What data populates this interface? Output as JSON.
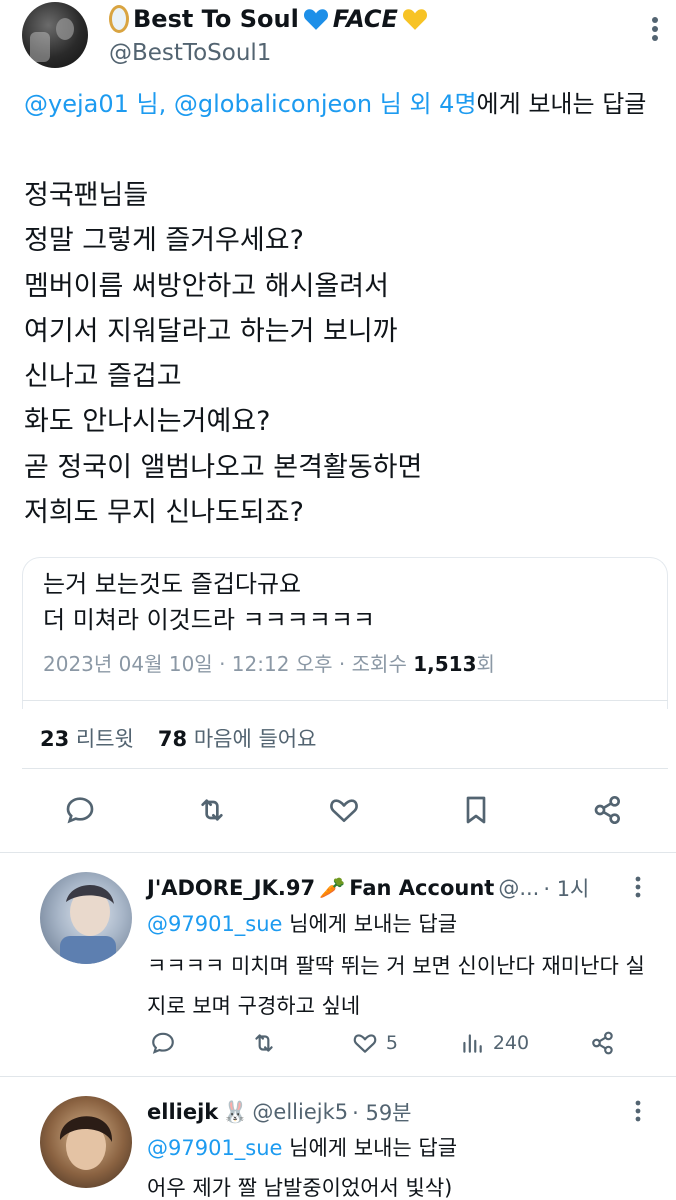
{
  "author": {
    "name_prefix": "Best To Soul",
    "name_face": "FACE",
    "handle": "@BestToSoul1",
    "blue_heart_color": "#1d8fe8",
    "yellow_heart_color": "#f7c325"
  },
  "reply_to": {
    "mention1": "@yeja01",
    "sep1": " 님, ",
    "mention2": "@globaliconjeon",
    "tail_link": " 님 외 4명",
    "suffix": "에게 보내는 답글"
  },
  "body_lines": [
    "정국팬님들",
    "정말 그렇게 즐거우세요?",
    "멤버이름 써방안하고 해시올려서",
    "여기서 지워달라고 하는거 보니까",
    "신나고 즐겁고",
    "화도 안나시는거예요?",
    "곧 정국이 앨범나오고 본격활동하면",
    "저희도 무지 신나도되죠?"
  ],
  "quote": {
    "line1": "는거 보는것도 즐겁다규요",
    "line2": "더 미쳐라 이것드라 ㅋㅋㅋㅋㅋㅋ",
    "meta_prefix": "2023년 04월 10일 · 12:12 오후 · 조회수 ",
    "views": "1,513",
    "views_suffix": "회",
    "retweets": "23",
    "retweets_label": "리트윗",
    "likes": "78",
    "likes_label": "마음에 들어요"
  },
  "replies": [
    {
      "name": "J'ADORE_JK.97",
      "badge": "🥕",
      "name_suffix": "Fan Account",
      "handle": "@...",
      "time": "· 1시",
      "to_mention": "@97901_sue",
      "to_suffix": " 님에게 보내는 답글",
      "text": "ㅋㅋㅋㅋ 미치며 팔딱 뛰는 거 보면 신이난다 재미난다 실지로 보며 구경하고 싶네",
      "likes": "5",
      "views": "240"
    },
    {
      "name": "elliejk",
      "badge": "🐰",
      "name_suffix": "",
      "handle": "@elliejk5",
      "time": "· 59분",
      "to_mention": "@97901_sue",
      "to_suffix": " 님에게 보내는 답글",
      "text": "어우 제가 짤 남발중이었어서 빛삭)",
      "likes": "",
      "views": ""
    }
  ],
  "colors": {
    "link": "#1d9bf0",
    "muted": "#536471",
    "text": "#0f1419"
  }
}
